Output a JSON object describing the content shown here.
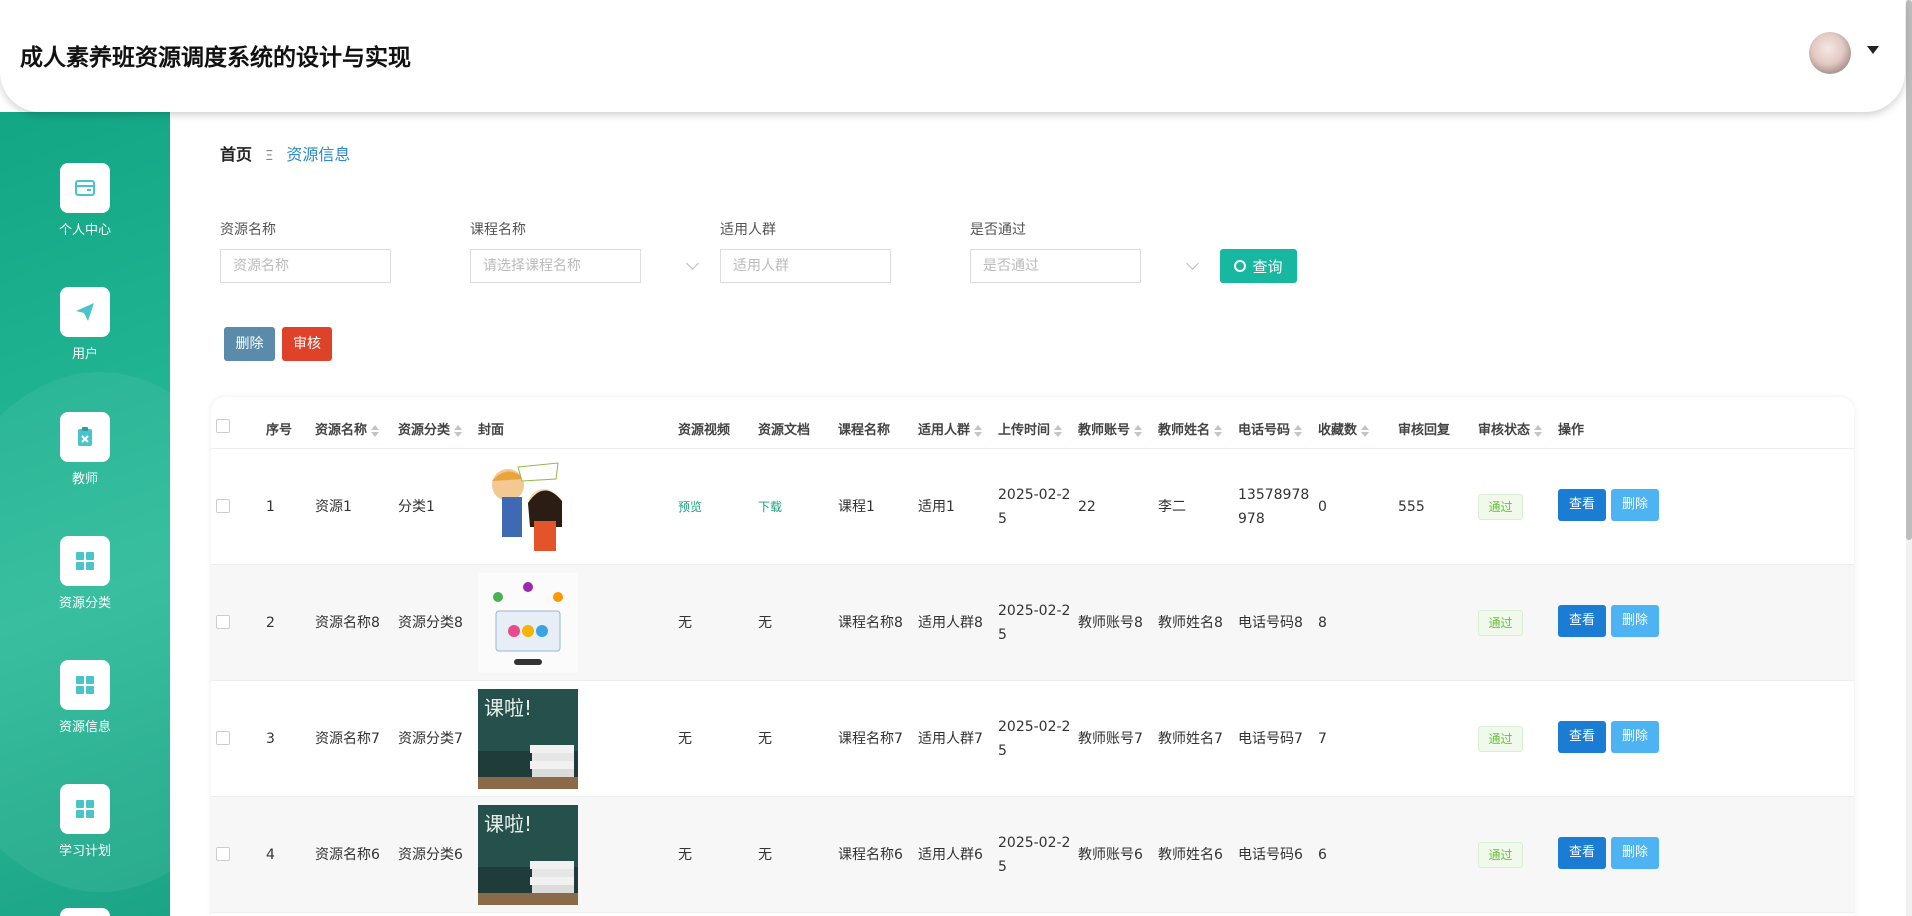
{
  "app": {
    "title": "成人素养班资源调度系统的设计与实现"
  },
  "sidebar": {
    "items": [
      {
        "label": "个人中心",
        "icon": "wallet-icon"
      },
      {
        "label": "用户",
        "icon": "paper-plane-icon"
      },
      {
        "label": "教师",
        "icon": "clipboard-icon"
      },
      {
        "label": "资源分类",
        "icon": "grid-icon"
      },
      {
        "label": "资源信息",
        "icon": "grid-icon"
      },
      {
        "label": "学习计划",
        "icon": "grid-icon"
      }
    ]
  },
  "breadcrumb": {
    "home": "首页",
    "separator": "Ξ",
    "current": "资源信息"
  },
  "filters": {
    "resource_name": {
      "label": "资源名称",
      "placeholder": "资源名称"
    },
    "course_name": {
      "label": "课程名称",
      "placeholder": "请选择课程名称"
    },
    "audience": {
      "label": "适用人群",
      "placeholder": "适用人群"
    },
    "passed": {
      "label": "是否通过",
      "placeholder": "是否通过"
    },
    "query_label": "查询"
  },
  "actions": {
    "delete_label": "删除",
    "audit_label": "审核"
  },
  "table": {
    "headers": {
      "index": "序号",
      "name": "资源名称",
      "category": "资源分类",
      "cover": "封面",
      "video": "资源视频",
      "doc": "资源文档",
      "course": "课程名称",
      "audience": "适用人群",
      "upload_time": "上传时间",
      "teacher_account": "教师账号",
      "teacher_name": "教师姓名",
      "phone": "电话号码",
      "favorites": "收藏数",
      "review_reply": "审核回复",
      "review_status": "审核状态",
      "operation": "操作"
    },
    "rows": [
      {
        "index": "1",
        "name": "资源1",
        "category": "分类1",
        "video": "预览",
        "doc": "下载",
        "course": "课程1",
        "audience": "适用1",
        "upload_time": "2025-02-25",
        "teacher_account": "22",
        "teacher_name": "李二",
        "phone": "13578978978",
        "favorites": "0",
        "review_reply": "555",
        "status": "通过",
        "view": "查看",
        "remove": "删除"
      },
      {
        "index": "2",
        "name": "资源名称8",
        "category": "资源分类8",
        "video": "无",
        "doc": "无",
        "course": "课程名称8",
        "audience": "适用人群8",
        "upload_time": "2025-02-25",
        "teacher_account": "教师账号8",
        "teacher_name": "教师姓名8",
        "phone": "电话号码8",
        "favorites": "8",
        "review_reply": "",
        "status": "通过",
        "view": "查看",
        "remove": "删除"
      },
      {
        "index": "3",
        "name": "资源名称7",
        "category": "资源分类7",
        "video": "无",
        "doc": "无",
        "course": "课程名称7",
        "audience": "适用人群7",
        "upload_time": "2025-02-25",
        "teacher_account": "教师账号7",
        "teacher_name": "教师姓名7",
        "phone": "电话号码7",
        "favorites": "7",
        "review_reply": "",
        "status": "通过",
        "view": "查看",
        "remove": "删除"
      },
      {
        "index": "4",
        "name": "资源名称6",
        "category": "资源分类6",
        "video": "无",
        "doc": "无",
        "course": "课程名称6",
        "audience": "适用人群6",
        "upload_time": "2025-02-25",
        "teacher_account": "教师账号6",
        "teacher_name": "教师姓名6",
        "phone": "电话号码6",
        "favorites": "6",
        "review_reply": "",
        "status": "通过",
        "view": "查看",
        "remove": "删除"
      }
    ]
  },
  "colors": {
    "accent": "#17b7a0",
    "sidebar": "#1fb392",
    "danger": "#de4329",
    "primary": "#1a7cd2"
  }
}
